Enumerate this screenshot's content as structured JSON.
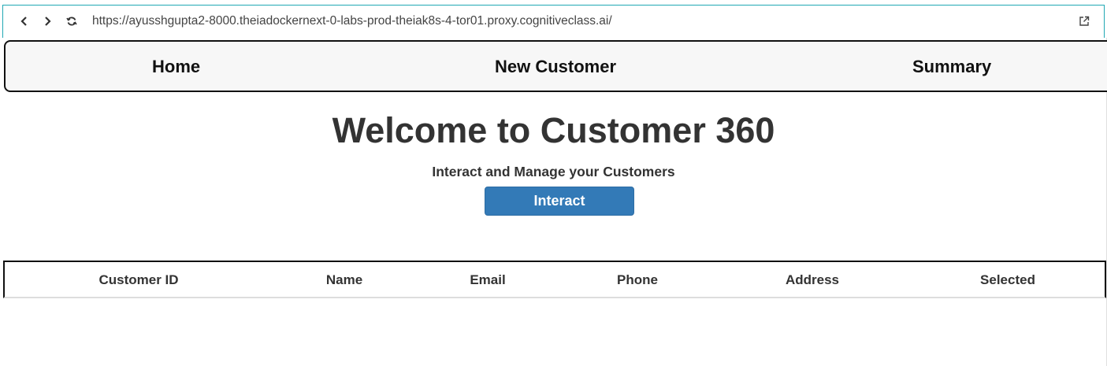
{
  "browser": {
    "url": "https://ayusshgupta2-8000.theiadockernext-0-labs-prod-theiak8s-4-tor01.proxy.cognitiveclass.ai/",
    "back_icon": "‹",
    "forward_icon": "›",
    "reload_icon": "⟳",
    "external_icon": "⧉"
  },
  "nav": {
    "home": "Home",
    "new_customer": "New Customer",
    "summary": "Summary"
  },
  "hero": {
    "title": "Welcome to Customer 360",
    "subtitle": "Interact and Manage your Customers",
    "button": "Interact"
  },
  "table": {
    "columns": [
      "Customer ID",
      "Name",
      "Email",
      "Phone",
      "Address",
      "Selected"
    ]
  },
  "colors": {
    "primary_button": "#337ab7",
    "browser_border": "#20a8b4"
  }
}
